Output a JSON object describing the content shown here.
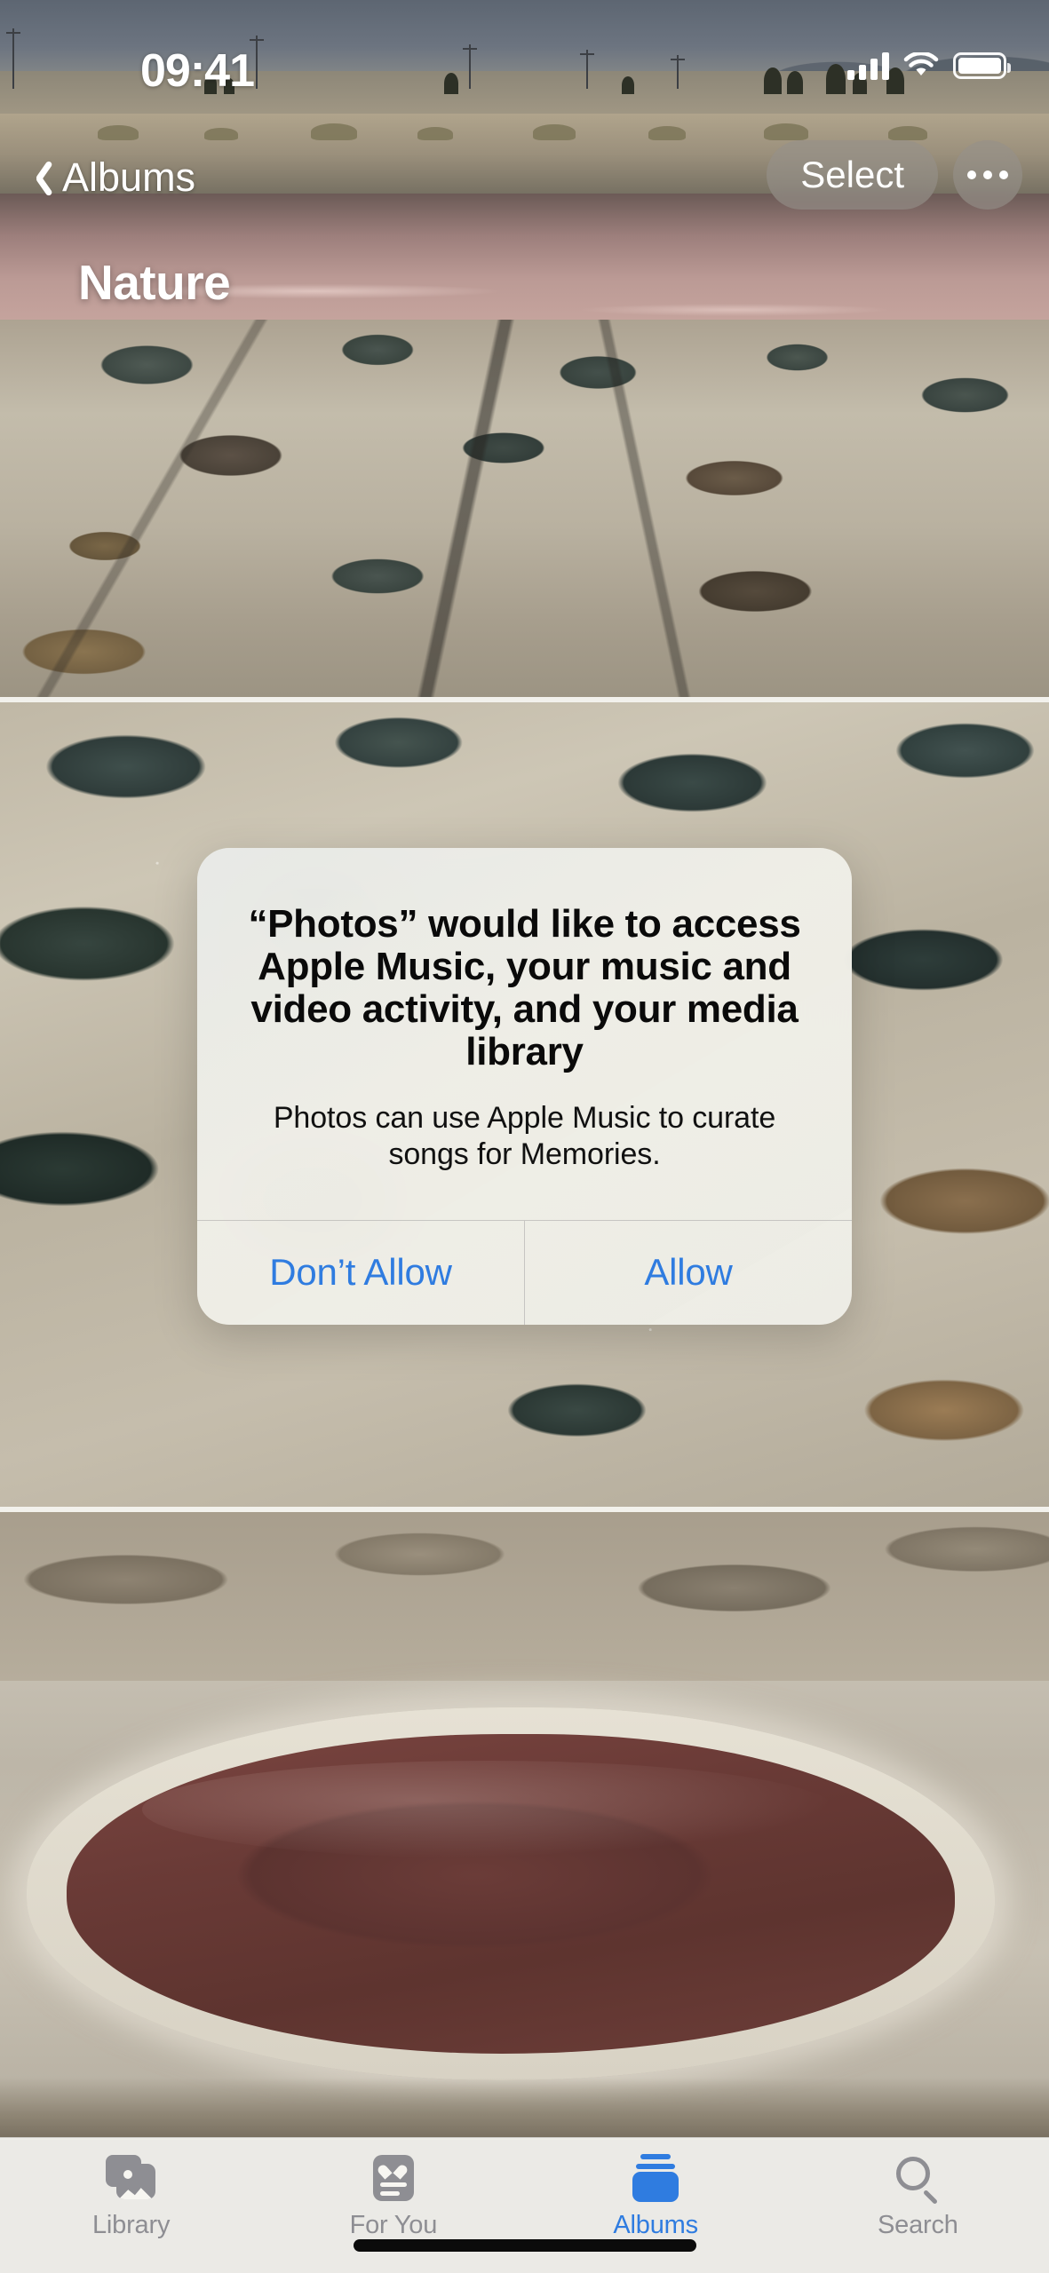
{
  "status_bar": {
    "time": "09:41",
    "cellular_icon": "cellular-signal-icon",
    "wifi_icon": "wifi-icon",
    "battery_icon": "battery-icon"
  },
  "nav_bar": {
    "back_icon": "chevron-left-icon",
    "back_label": "Albums",
    "select_label": "Select",
    "more_icon": "ellipsis-icon"
  },
  "album": {
    "title": "Nature"
  },
  "alert": {
    "title": "“Photos” would like to access Apple Music, your music and video activity, and your media library",
    "message": "Photos can use Apple Music to curate songs for Memories.",
    "deny_label": "Don’t Allow",
    "allow_label": "Allow",
    "button_color": "#2f7ce0"
  },
  "tab_bar": {
    "tabs": [
      {
        "label": "Library",
        "icon": "photo-stack-icon",
        "active": false
      },
      {
        "label": "For You",
        "icon": "heart-card-icon",
        "active": false
      },
      {
        "label": "Albums",
        "icon": "albums-stack-icon",
        "active": true
      },
      {
        "label": "Search",
        "icon": "magnifier-icon",
        "active": false
      }
    ],
    "active_color": "#2f7ce0",
    "inactive_color": "#8e8e93"
  },
  "home_indicator": "home-indicator"
}
